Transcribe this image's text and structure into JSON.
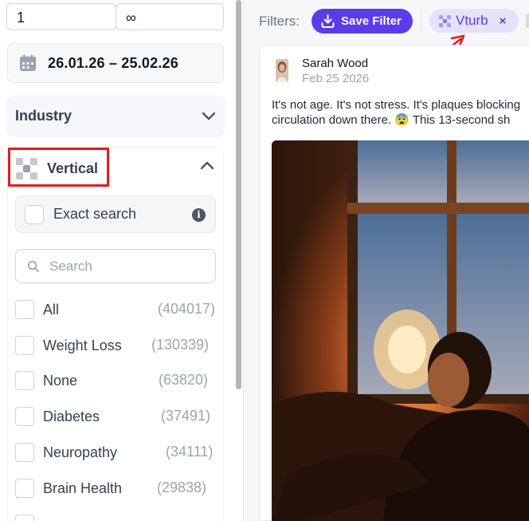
{
  "sidebar": {
    "range": {
      "min": "1",
      "max": "∞"
    },
    "date_range": "26.01.26 – 25.02.26",
    "industry": {
      "label": "Industry"
    },
    "vertical": {
      "label": "Vertical",
      "exact_search_label": "Exact search",
      "search_placeholder": "Search",
      "options": [
        {
          "label": "All",
          "count": "(404017)"
        },
        {
          "label": "Weight Loss",
          "count": "(130339)"
        },
        {
          "label": "None",
          "count": "(63820)"
        },
        {
          "label": "Diabetes",
          "count": "(37491)"
        },
        {
          "label": "Neuropathy",
          "count": "(34111)"
        },
        {
          "label": "Brain Health",
          "count": "(29838)"
        }
      ]
    }
  },
  "filters": {
    "label": "Filters:",
    "save_filter_label": "Save Filter",
    "active_chip": {
      "label": "Vturb",
      "close": "×"
    }
  },
  "post": {
    "author": "Sarah Wood",
    "date": "Feb 25 2026",
    "text_line1": "It's not age. It's not stress. It's plaques blocking",
    "text_line2": "circulation down there. 😨 This 13-second sh"
  },
  "colors": {
    "accent": "#5b3ce8",
    "chip_bg": "#e6e2fb",
    "highlight": "#e11d1d"
  }
}
